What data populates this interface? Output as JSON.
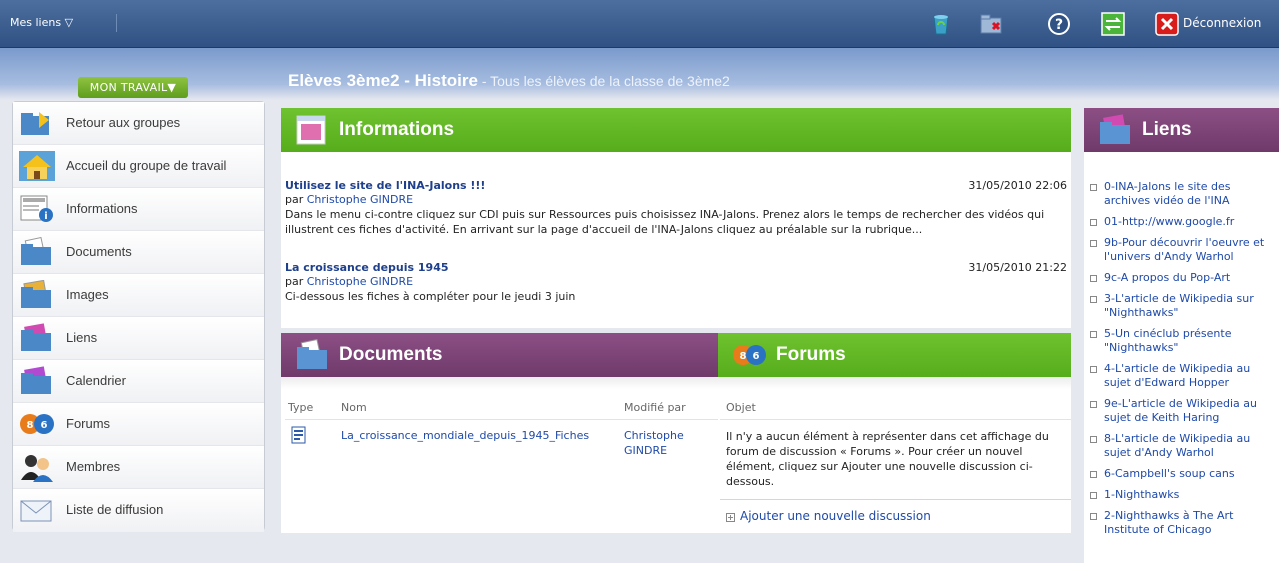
{
  "topbar": {
    "mes_liens": "Mes liens ▽",
    "deconnexion": "Déconnexion"
  },
  "nav": {
    "mon_travail": "MON TRAVAIL▼",
    "items": [
      {
        "label": "Retour aux groupes",
        "icon": "folder-return-icon"
      },
      {
        "label": "Accueil du groupe de travail",
        "icon": "home-icon"
      },
      {
        "label": "Informations",
        "icon": "info-icon"
      },
      {
        "label": "Documents",
        "icon": "documents-icon"
      },
      {
        "label": "Images",
        "icon": "images-icon"
      },
      {
        "label": "Liens",
        "icon": "links-icon"
      },
      {
        "label": "Calendrier",
        "icon": "calendar-icon"
      },
      {
        "label": "Forums",
        "icon": "forums-icon"
      },
      {
        "label": "Membres",
        "icon": "members-icon"
      },
      {
        "label": "Liste de diffusion",
        "icon": "mail-icon"
      }
    ]
  },
  "page": {
    "title": "Elèves 3ème2 - Histoire",
    "subtitle": " - Tous les élèves de la classe de 3ème2"
  },
  "informations": {
    "header": "Informations",
    "items": [
      {
        "title": "Utilisez le site de l'INA-Jalons !!!",
        "by_prefix": "par ",
        "author": "Christophe GINDRE",
        "date": "31/05/2010 22:06",
        "body": "Dans le menu ci-contre cliquez sur CDI puis sur Ressources puis choisissez INA-Jalons. Prenez alors le temps de rechercher des vidéos qui illustrent ces fiches d'activité. En arrivant sur la page d'accueil de l'INA-Jalons cliquez au préalable sur la rubrique..."
      },
      {
        "title": "La croissance depuis 1945",
        "by_prefix": "par ",
        "author": "Christophe GINDRE",
        "date": "31/05/2010 21:22",
        "body": "Ci-dessous les fiches à compléter pour le jeudi 3 juin"
      }
    ]
  },
  "documents": {
    "header": "Documents",
    "columns": [
      "Type",
      "Nom",
      "Modifié par"
    ],
    "rows": [
      {
        "name": "La_croissance_mondiale_depuis_1945_Fiches",
        "modified_by_1": "Christophe",
        "modified_by_2": "GINDRE"
      }
    ]
  },
  "forums": {
    "header": "Forums",
    "column": "Objet",
    "empty_message": "Il n'y a aucun élément à représenter dans cet affichage du forum de discussion « Forums ». Pour créer un nouvel élément, cliquez sur Ajouter une nouvelle discussion ci-dessous.",
    "add_link": "Ajouter une nouvelle discussion"
  },
  "liens": {
    "header": "Liens",
    "items": [
      "0-INA-Jalons le site des archives vidéo de l'INA",
      "01-http://www.google.fr",
      "9b-Pour découvrir l'oeuvre et l'univers d'Andy Warhol",
      "9c-A propos du Pop-Art",
      "3-L'article de Wikipedia sur \"Nighthawks\"",
      "5-Un cinéclub présente \"Nighthawks\"",
      "4-L'article de Wikipedia au sujet d'Edward Hopper",
      "9e-L'article de Wikipedia au sujet de Keith Haring",
      "8-L'article de Wikipedia au sujet d'Andy Warhol",
      "6-Campbell's soup cans",
      "1-Nighthawks",
      "2-Nighthawks à The Art Institute of Chicago"
    ]
  }
}
